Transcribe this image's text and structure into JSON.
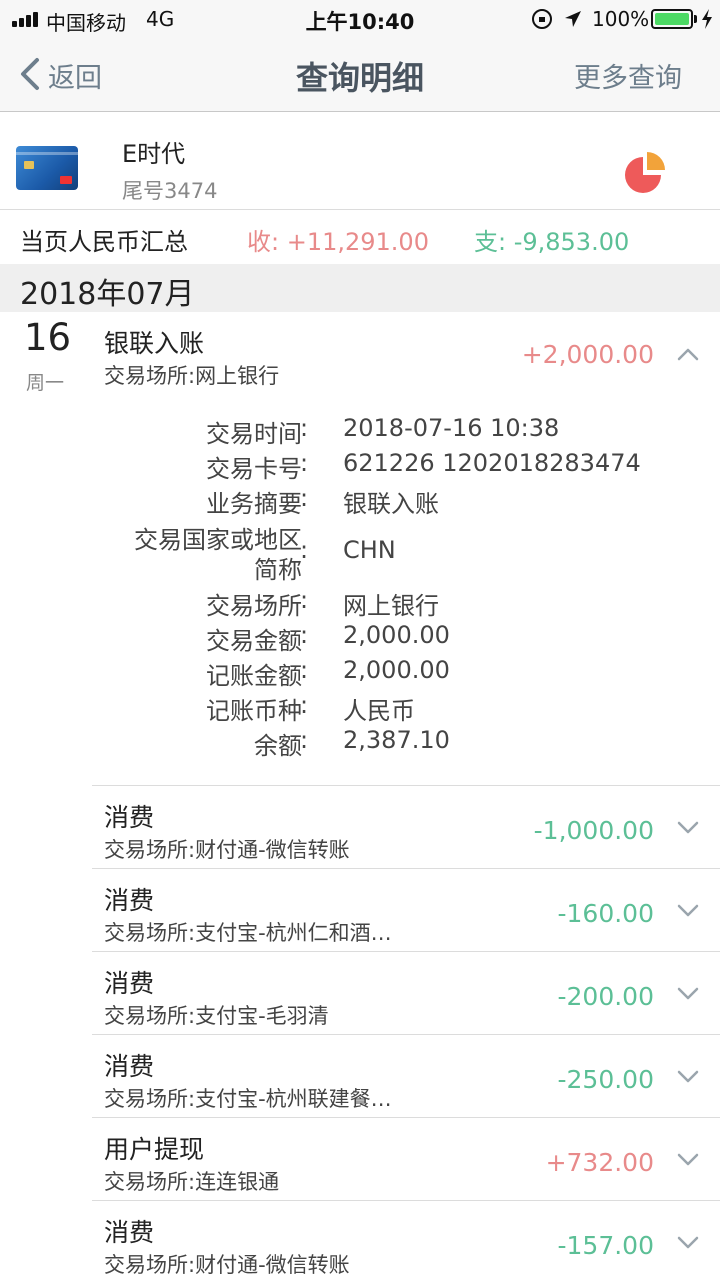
{
  "status_bar": {
    "carrier": "中国移动",
    "network": "4G",
    "time": "上午10:40",
    "battery_percent": "100%",
    "battery_color": "#4cd964"
  },
  "nav": {
    "back_label": "返回",
    "title": "查询明细",
    "more_label": "更多查询"
  },
  "card": {
    "name": "E时代",
    "tail": "尾号3474",
    "icon": "pie-chart-icon"
  },
  "summary": {
    "label": "当页人民币汇总",
    "income": "收: +11,291.00",
    "expense": "支: -9,853.00"
  },
  "month": "2018年07月",
  "date": {
    "day": "16",
    "weekday": "周一"
  },
  "expanded": {
    "title": "银联入账",
    "place": "交易场所:网上银行",
    "amount": "+2,000.00",
    "details": [
      {
        "label": "交易时间",
        "value": "2018-07-16 10:38"
      },
      {
        "label": "交易卡号",
        "value": "621226 1202018283474"
      },
      {
        "label": "业务摘要",
        "value": "银联入账"
      },
      {
        "label": "交易国家或地区",
        "label2": "简称",
        "value": "CHN"
      },
      {
        "label": "交易场所",
        "value": "网上银行"
      },
      {
        "label": "交易金额",
        "value": "2,000.00"
      },
      {
        "label": "记账金额",
        "value": "2,000.00"
      },
      {
        "label": "记账币种",
        "value": "人民币"
      },
      {
        "label": "余额",
        "value": "2,387.10"
      }
    ]
  },
  "transactions": [
    {
      "title": "消费",
      "place": "交易场所:财付通-微信转账",
      "amount": "-1,000.00"
    },
    {
      "title": "消费",
      "place": "交易场所:支付宝-杭州仁和酒…",
      "amount": "-160.00"
    },
    {
      "title": "消费",
      "place": "交易场所:支付宝-毛羽清",
      "amount": "-200.00"
    },
    {
      "title": "消费",
      "place": "交易场所:支付宝-杭州联建餐…",
      "amount": "-250.00"
    },
    {
      "title": "用户提现",
      "place": "交易场所:连连银通",
      "amount": "+732.00"
    },
    {
      "title": "消费",
      "place": "交易场所:财付通-微信转账",
      "amount": "-157.00"
    }
  ],
  "colors": {
    "income": "#e88a8a",
    "expense": "#5cbf96",
    "nav_text": "#6d7e8c"
  }
}
